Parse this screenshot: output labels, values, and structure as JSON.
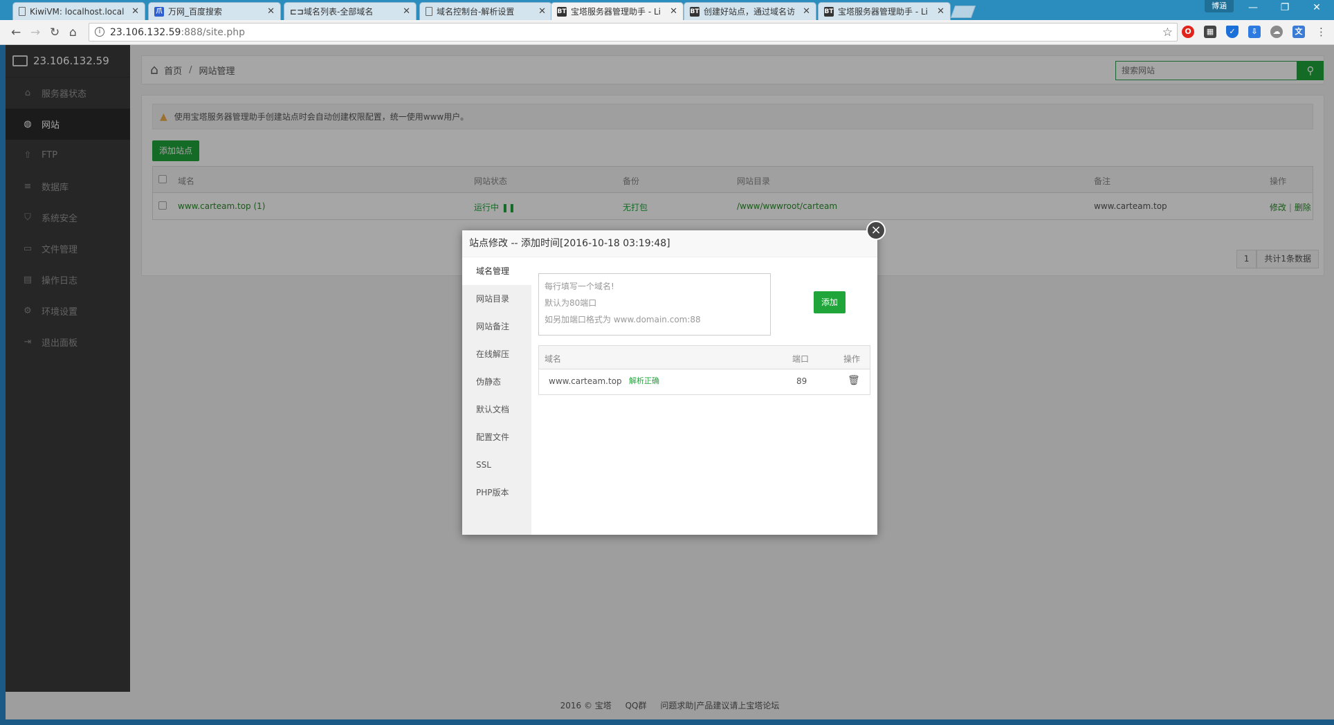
{
  "browser": {
    "tabs": [
      {
        "label": "KiwiVM: localhost.local",
        "icon": "page",
        "active": false
      },
      {
        "label": "万网_百度搜索",
        "icon": "paw",
        "active": false
      },
      {
        "label": "域名列表-全部域名",
        "icon": "link",
        "active": false
      },
      {
        "label": "域名控制台-解析设置",
        "icon": "page",
        "active": false
      },
      {
        "label": "宝塔服务器管理助手 - Li",
        "icon": "BT",
        "active": true
      },
      {
        "label": "创建好站点，通过域名访",
        "icon": "BT",
        "active": false
      },
      {
        "label": "宝塔服务器管理助手 - Li",
        "icon": "BT",
        "active": false
      }
    ],
    "profile": "博涵",
    "url_host": "23.106.132.59",
    "url_rest": ":888/site.php"
  },
  "sidebar": {
    "host": "23.106.132.59",
    "items": [
      {
        "label": "服务器状态",
        "icon": "home-icon",
        "glyph": "⌂"
      },
      {
        "label": "网站",
        "icon": "globe-icon",
        "glyph": "◍"
      },
      {
        "label": "FTP",
        "icon": "upload-icon",
        "glyph": "⇧"
      },
      {
        "label": "数据库",
        "icon": "database-icon",
        "glyph": "≡"
      },
      {
        "label": "系统安全",
        "icon": "shield-icon",
        "glyph": "⛉"
      },
      {
        "label": "文件管理",
        "icon": "folder-icon",
        "glyph": "▭"
      },
      {
        "label": "操作日志",
        "icon": "log-icon",
        "glyph": "▤"
      },
      {
        "label": "环境设置",
        "icon": "gear-icon",
        "glyph": "⚙"
      },
      {
        "label": "退出面板",
        "icon": "logout-icon",
        "glyph": "⇥"
      }
    ]
  },
  "breadcrumb": {
    "home": "首页",
    "current": "网站管理"
  },
  "search": {
    "placeholder": "搜索网站"
  },
  "notice": "使用宝塔服务器管理助手创建站点时会自动创建权限配置，统一使用www用户。",
  "add_site_label": "添加站点",
  "table": {
    "headers": {
      "domain": "域名",
      "status": "网站状态",
      "backup": "备份",
      "dir": "网站目录",
      "note": "备注",
      "ops": "操作"
    },
    "rows": [
      {
        "domain": "www.carteam.top (1)",
        "status": "运行中",
        "backup": "无打包",
        "dir": "/www/wwwroot/carteam",
        "note": "www.carteam.top",
        "edit": "修改",
        "sep": "|",
        "delete": "删除"
      }
    ]
  },
  "pager": {
    "page": "1",
    "total": "共计1条数据"
  },
  "footer": {
    "copyright": "2016 © 宝塔",
    "qq": "QQ群",
    "help": "问题求助|产品建议请上宝塔论坛"
  },
  "modal": {
    "title": "站点修改 -- 添加时间[2016-10-18 03:19:48]",
    "tabs": [
      "域名管理",
      "网站目录",
      "网站备注",
      "在线解压",
      "伪静态",
      "默认文档",
      "配置文件",
      "SSL",
      "PHP版本"
    ],
    "textarea_lines": [
      "每行填写一个域名!",
      "默认为80端口",
      "如另加端口格式为 www.domain.com:88"
    ],
    "add_label": "添加",
    "headers": {
      "domain": "域名",
      "port": "端口",
      "ops": "操作"
    },
    "rows": [
      {
        "domain": "www.carteam.top",
        "resolve": "解析正确",
        "port": "89"
      }
    ]
  }
}
